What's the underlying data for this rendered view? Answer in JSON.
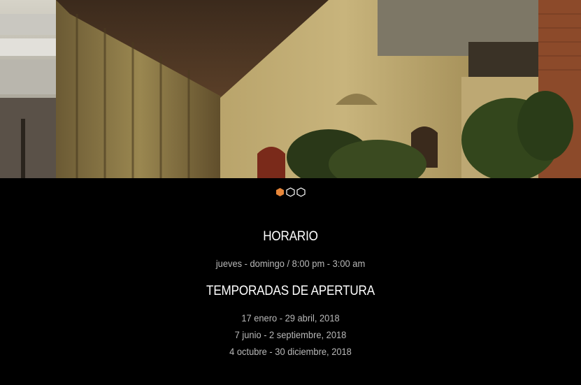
{
  "hero": {
    "image": "historic-stone-building-photo"
  },
  "slider": {
    "active_index": 0,
    "dot_count": 3,
    "active_color": "#e8873a",
    "inactive_color": "#ffffff"
  },
  "schedule": {
    "heading": "HORARIO",
    "hours": "jueves - domingo / 8:00 pm - 3:00 am"
  },
  "seasons": {
    "heading": "TEMPORADAS DE APERTURA",
    "dates": [
      "17 enero - 29 abril, 2018",
      "7 junio - 2 septiembre, 2018",
      "4 octubre - 30 diciembre, 2018"
    ]
  }
}
